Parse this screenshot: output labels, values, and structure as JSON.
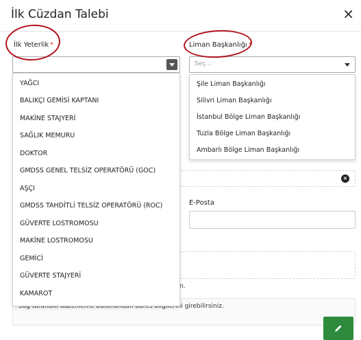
{
  "modal": {
    "title": "İlk Cüzdan Talebi",
    "close_glyph": "×"
  },
  "left_field": {
    "label": "İlk Yeterlik",
    "required_mark": "*",
    "options": [
      "YAĞCI",
      "BALIKÇI GEMİSİ KAPTANI",
      "MAKİNE STAJYERİ",
      "SAĞLIK MEMURU",
      "DOKTOR",
      "GMDSS GENEL TELSİZ OPERATÖRÜ (GOC)",
      "AŞÇI",
      "GMDSS TAHDİTLİ TELSİZ OPERATÖRÜ (ROC)",
      "GÜVERTE LOSTROMOSU",
      "MAKİNE LOSTROMOSU",
      "GEMİCİ",
      "GÜVERTE STAJYERİ",
      "KAMAROT"
    ]
  },
  "right_field": {
    "label": "Liman Başkanlığı",
    "required_mark": "*",
    "placeholder": "Seç...",
    "options": [
      "Şile Liman Başkanlığı",
      "Silivri Liman Başkanlığı",
      "İstanbul Bölge Liman Başkanlığı",
      "Tuzla Bölge Liman Başkanlığı",
      "Ambarlı Bölge Liman Başkanlığı"
    ]
  },
  "email": {
    "label": "E-Posta"
  },
  "background_fragment": "n.",
  "address": {
    "hint": "Sağ taraftaki düzenleme butonundan adres bilgilerini girebilirsiniz."
  },
  "colors": {
    "annotation": "#b0121a",
    "edit_button": "#2e8b3e"
  },
  "icons": {
    "close": "close-icon",
    "clear": "x-circle-icon",
    "edit": "pencil-icon"
  }
}
